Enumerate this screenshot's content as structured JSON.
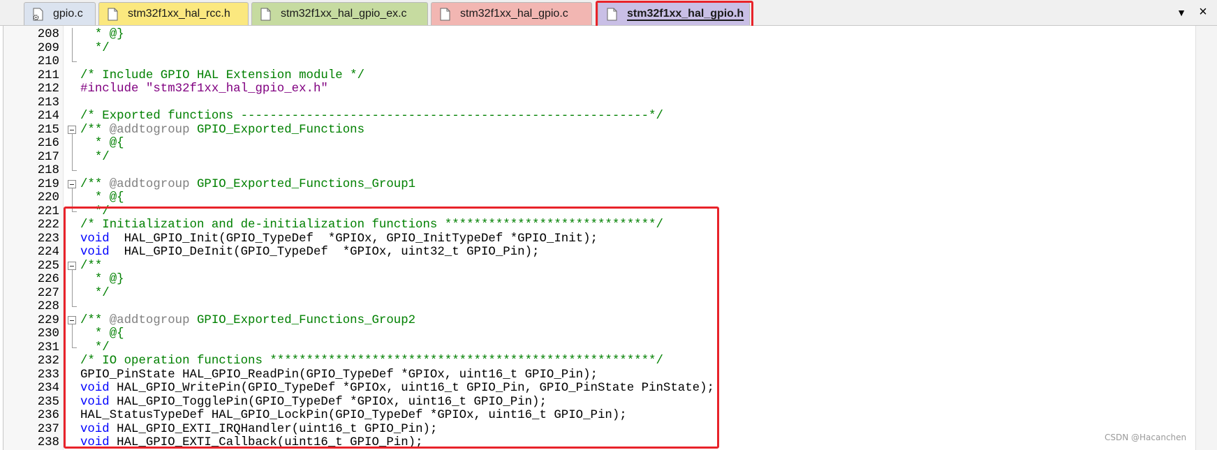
{
  "tabs": [
    {
      "label": "gpio.c",
      "bg": "#dbe3ef",
      "icon": "gear-file-icon",
      "active": false
    },
    {
      "label": "stm32f1xx_hal_rcc.h",
      "bg": "#fbe87f",
      "icon": "file-icon",
      "active": false
    },
    {
      "label": "stm32f1xx_hal_gpio_ex.c",
      "bg": "#c6dba0",
      "icon": "file-icon",
      "active": false
    },
    {
      "label": "stm32f1xx_hal_gpio.c",
      "bg": "#f2b6b2",
      "icon": "file-icon",
      "active": false
    },
    {
      "label": "stm32f1xx_hal_gpio.h",
      "bg": "#c9bfe6",
      "icon": "file-icon",
      "active": true
    }
  ],
  "tab_controls": {
    "dropdown": "▼",
    "close": "×"
  },
  "colors": {
    "highlight": "#e8232a",
    "comment": "#008000",
    "keyword": "#0000ff",
    "preprocessor": "#800080",
    "doc_tag": "#808080"
  },
  "lines": [
    {
      "num": "208",
      "fold": "line",
      "tokens": [
        {
          "t": "  * @}",
          "c": "c-comment"
        }
      ]
    },
    {
      "num": "209",
      "fold": "line",
      "tokens": [
        {
          "t": "  */",
          "c": "c-comment"
        }
      ]
    },
    {
      "num": "210",
      "fold": "end",
      "tokens": []
    },
    {
      "num": "211",
      "fold": "",
      "tokens": [
        {
          "t": "/* Include GPIO HAL Extension module */",
          "c": "c-comment"
        }
      ]
    },
    {
      "num": "212",
      "fold": "",
      "tokens": [
        {
          "t": "#include ",
          "c": "c-pre"
        },
        {
          "t": "\"stm32f1xx_hal_gpio_ex.h\"",
          "c": "c-string"
        }
      ]
    },
    {
      "num": "213",
      "fold": "",
      "tokens": []
    },
    {
      "num": "214",
      "fold": "",
      "tokens": [
        {
          "t": "/* Exported functions --------------------------------------------------------*/",
          "c": "c-comment"
        }
      ]
    },
    {
      "num": "215",
      "fold": "box",
      "tokens": [
        {
          "t": "/** ",
          "c": "c-comment"
        },
        {
          "t": "@addtogroup",
          "c": "c-doctag"
        },
        {
          "t": " GPIO_Exported_Functions",
          "c": "c-comment"
        }
      ]
    },
    {
      "num": "216",
      "fold": "line",
      "tokens": [
        {
          "t": "  * @{",
          "c": "c-comment"
        }
      ]
    },
    {
      "num": "217",
      "fold": "line",
      "tokens": [
        {
          "t": "  */",
          "c": "c-comment"
        }
      ]
    },
    {
      "num": "218",
      "fold": "end",
      "tokens": []
    },
    {
      "num": "219",
      "fold": "box",
      "tokens": [
        {
          "t": "/** ",
          "c": "c-comment"
        },
        {
          "t": "@addtogroup",
          "c": "c-doctag"
        },
        {
          "t": " GPIO_Exported_Functions_Group1",
          "c": "c-comment"
        }
      ]
    },
    {
      "num": "220",
      "fold": "line",
      "tokens": [
        {
          "t": "  * @{",
          "c": "c-comment"
        }
      ]
    },
    {
      "num": "221",
      "fold": "end",
      "tokens": [
        {
          "t": "  */",
          "c": "c-comment"
        }
      ]
    },
    {
      "num": "222",
      "fold": "",
      "tokens": [
        {
          "t": "/* Initialization and de-initialization functions *****************************/",
          "c": "c-comment"
        }
      ]
    },
    {
      "num": "223",
      "fold": "",
      "tokens": [
        {
          "t": "void",
          "c": "c-keyword"
        },
        {
          "t": "  HAL_GPIO_Init(GPIO_TypeDef  *GPIOx, GPIO_InitTypeDef *GPIO_Init);",
          "c": "c-plain"
        }
      ]
    },
    {
      "num": "224",
      "fold": "",
      "tokens": [
        {
          "t": "void",
          "c": "c-keyword"
        },
        {
          "t": "  HAL_GPIO_DeInit(GPIO_TypeDef  *GPIOx, uint32_t GPIO_Pin);",
          "c": "c-plain"
        }
      ]
    },
    {
      "num": "225",
      "fold": "box",
      "tokens": [
        {
          "t": "/**",
          "c": "c-comment"
        }
      ]
    },
    {
      "num": "226",
      "fold": "line",
      "tokens": [
        {
          "t": "  * @}",
          "c": "c-comment"
        }
      ]
    },
    {
      "num": "227",
      "fold": "line",
      "tokens": [
        {
          "t": "  */",
          "c": "c-comment"
        }
      ]
    },
    {
      "num": "228",
      "fold": "end",
      "tokens": []
    },
    {
      "num": "229",
      "fold": "box",
      "tokens": [
        {
          "t": "/** ",
          "c": "c-comment"
        },
        {
          "t": "@addtogroup",
          "c": "c-doctag"
        },
        {
          "t": " GPIO_Exported_Functions_Group2",
          "c": "c-comment"
        }
      ]
    },
    {
      "num": "230",
      "fold": "line",
      "tokens": [
        {
          "t": "  * @{",
          "c": "c-comment"
        }
      ]
    },
    {
      "num": "231",
      "fold": "end",
      "tokens": [
        {
          "t": "  */",
          "c": "c-comment"
        }
      ]
    },
    {
      "num": "232",
      "fold": "",
      "tokens": [
        {
          "t": "/* IO operation functions *****************************************************/",
          "c": "c-comment"
        }
      ]
    },
    {
      "num": "233",
      "fold": "",
      "tokens": [
        {
          "t": "GPIO_PinState HAL_GPIO_ReadPin(GPIO_TypeDef *GPIOx, uint16_t GPIO_Pin);",
          "c": "c-plain"
        }
      ]
    },
    {
      "num": "234",
      "fold": "",
      "tokens": [
        {
          "t": "void",
          "c": "c-keyword"
        },
        {
          "t": " HAL_GPIO_WritePin(GPIO_TypeDef *GPIOx, uint16_t GPIO_Pin, GPIO_PinState PinState);",
          "c": "c-plain"
        }
      ]
    },
    {
      "num": "235",
      "fold": "",
      "tokens": [
        {
          "t": "void",
          "c": "c-keyword"
        },
        {
          "t": " HAL_GPIO_TogglePin(GPIO_TypeDef *GPIOx, uint16_t GPIO_Pin);",
          "c": "c-plain"
        }
      ]
    },
    {
      "num": "236",
      "fold": "",
      "tokens": [
        {
          "t": "HAL_StatusTypeDef HAL_GPIO_LockPin(GPIO_TypeDef *GPIOx, uint16_t GPIO_Pin);",
          "c": "c-plain"
        }
      ]
    },
    {
      "num": "237",
      "fold": "",
      "tokens": [
        {
          "t": "void",
          "c": "c-keyword"
        },
        {
          "t": " HAL_GPIO_EXTI_IRQHandler(uint16_t GPIO_Pin);",
          "c": "c-plain"
        }
      ]
    },
    {
      "num": "238",
      "fold": "",
      "tokens": [
        {
          "t": "void",
          "c": "c-keyword"
        },
        {
          "t": " HAL_GPIO_EXTI_Callback(uint16_t GPIO_Pin);",
          "c": "c-plain"
        }
      ]
    }
  ],
  "watermark": "CSDN @Hacanchen"
}
